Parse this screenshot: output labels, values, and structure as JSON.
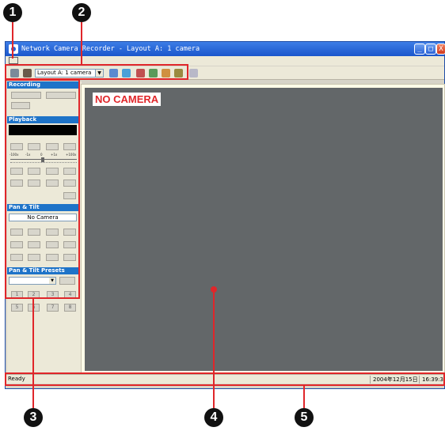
{
  "callouts": [
    "1",
    "2",
    "3",
    "4",
    "5"
  ],
  "window": {
    "title": "Network Camera Recorder - Layout A: 1 camera",
    "controls": {
      "minimize": "_",
      "maximize": "□",
      "close": "X"
    }
  },
  "toolbar": {
    "layout_select_value": "Layout A: 1 camera",
    "icons": [
      "properties-icon",
      "edit-icon",
      "layout-dropdown",
      "grid-a-icon",
      "grid-b-icon",
      "person-icon",
      "camera-add-icon",
      "cameras-icon",
      "settings-icon",
      "speaker-icon"
    ]
  },
  "left_panel": {
    "sections": {
      "recording": "Recording",
      "playback": "Playback",
      "pan_tilt": "Pan & Tilt",
      "presets": "Pan & Tilt Presets"
    },
    "speed_labels": [
      "-100x",
      "-1x",
      "0",
      "+1x",
      "+100x"
    ],
    "pan_tilt_camera": "No Camera",
    "preset_buttons": [
      "1",
      "2",
      "3",
      "4",
      "5",
      "6",
      "7",
      "8"
    ]
  },
  "view": {
    "no_camera_label": "NO CAMERA"
  },
  "status": {
    "left": "Ready",
    "date": "2004年12月15日",
    "time": "16:39:38"
  },
  "colors": {
    "title_bar": "#1a56cc",
    "section_header": "#1e73c8",
    "camera_view_bg": "#636769",
    "callout_line": "#e0262a"
  }
}
